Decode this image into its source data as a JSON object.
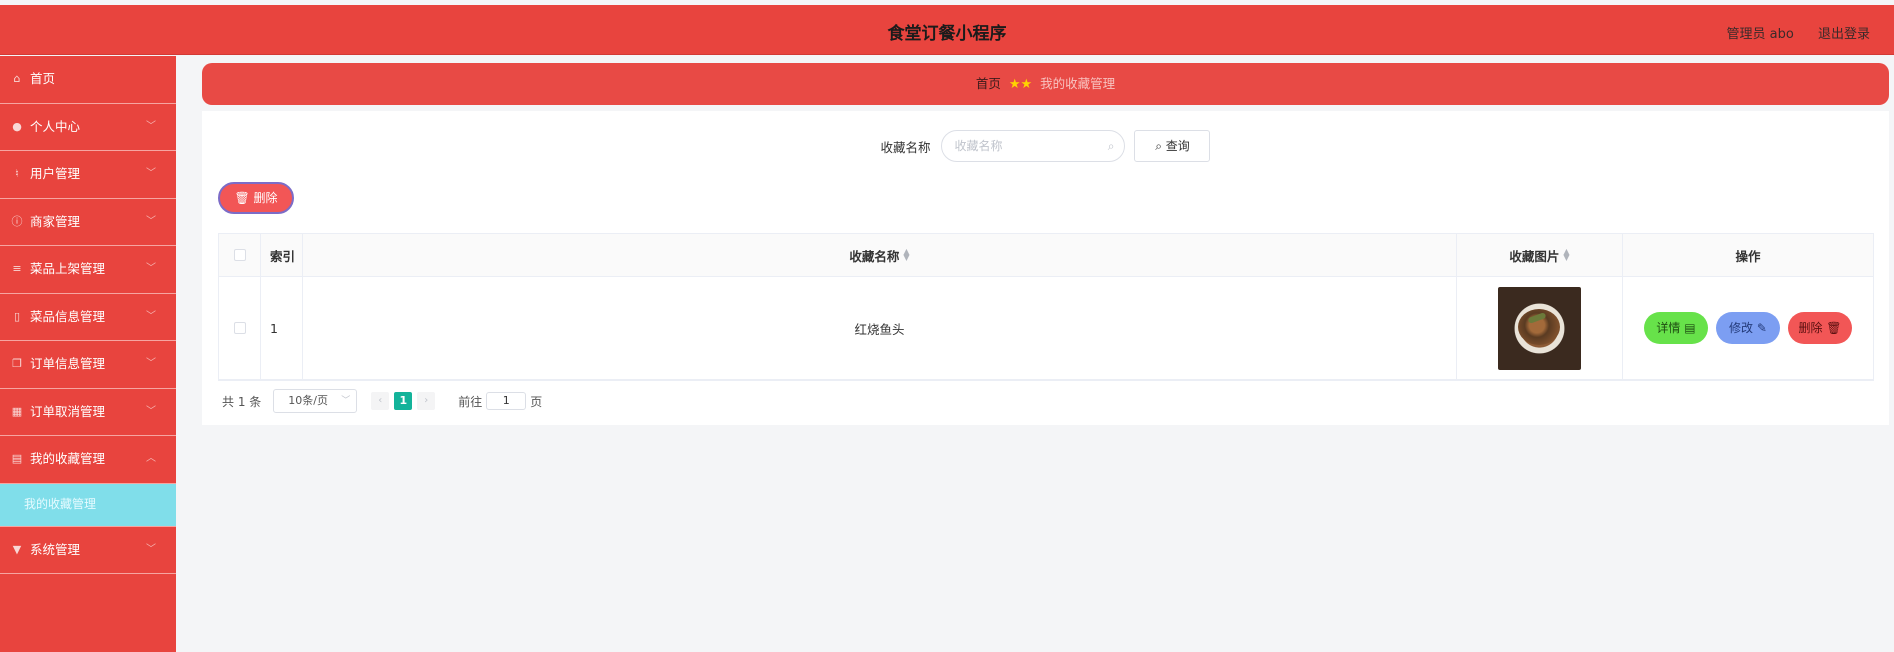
{
  "header": {
    "title": "食堂订餐小程序",
    "user_label": "管理员 abo",
    "logout_label": "退出登录"
  },
  "sidebar": {
    "items": [
      {
        "label": "首页",
        "icon": "home-icon",
        "has_chevron": false
      },
      {
        "label": "个人中心",
        "icon": "user-icon",
        "has_chevron": true
      },
      {
        "label": "用户管理",
        "icon": "microphone-icon",
        "has_chevron": true
      },
      {
        "label": "商家管理",
        "icon": "info-icon",
        "has_chevron": true
      },
      {
        "label": "菜品上架管理",
        "icon": "list-icon",
        "has_chevron": true
      },
      {
        "label": "菜品信息管理",
        "icon": "mobile-icon",
        "has_chevron": true
      },
      {
        "label": "订单信息管理",
        "icon": "copy-icon",
        "has_chevron": true
      },
      {
        "label": "订单取消管理",
        "icon": "clipboard-icon",
        "has_chevron": true
      },
      {
        "label": "我的收藏管理",
        "icon": "briefcase-icon",
        "has_chevron": true,
        "expanded": true
      }
    ],
    "sub_item": {
      "label": "我的收藏管理"
    },
    "last_item": {
      "label": "系统管理",
      "icon": "pushpin-icon",
      "has_chevron": true
    }
  },
  "breadcrumb": {
    "home": "首页",
    "current": "我的收藏管理"
  },
  "search": {
    "label": "收藏名称",
    "placeholder": "收藏名称",
    "button_label": "查询"
  },
  "toolbar": {
    "delete_label": "删除"
  },
  "table": {
    "columns": [
      "索引",
      "收藏名称",
      "收藏图片",
      "操作"
    ],
    "rows": [
      {
        "index": "1",
        "name": "红烧鱼头",
        "image": "braised-fish-head-photo"
      }
    ],
    "actions": {
      "detail": "详情",
      "edit": "修改",
      "delete": "删除"
    }
  },
  "pagination": {
    "total": "共 1 条",
    "page_size": "10条/页",
    "current_page": "1",
    "goto_label": "前往",
    "goto_value": "1",
    "page_suffix": "页"
  },
  "colors": {
    "primary": "#e8443e",
    "submenu_active": "#80deea",
    "detail_button": "#67e24a",
    "edit_button": "#7c9ef2",
    "delete_button": "#f25656",
    "pager_active": "#13b39a"
  }
}
